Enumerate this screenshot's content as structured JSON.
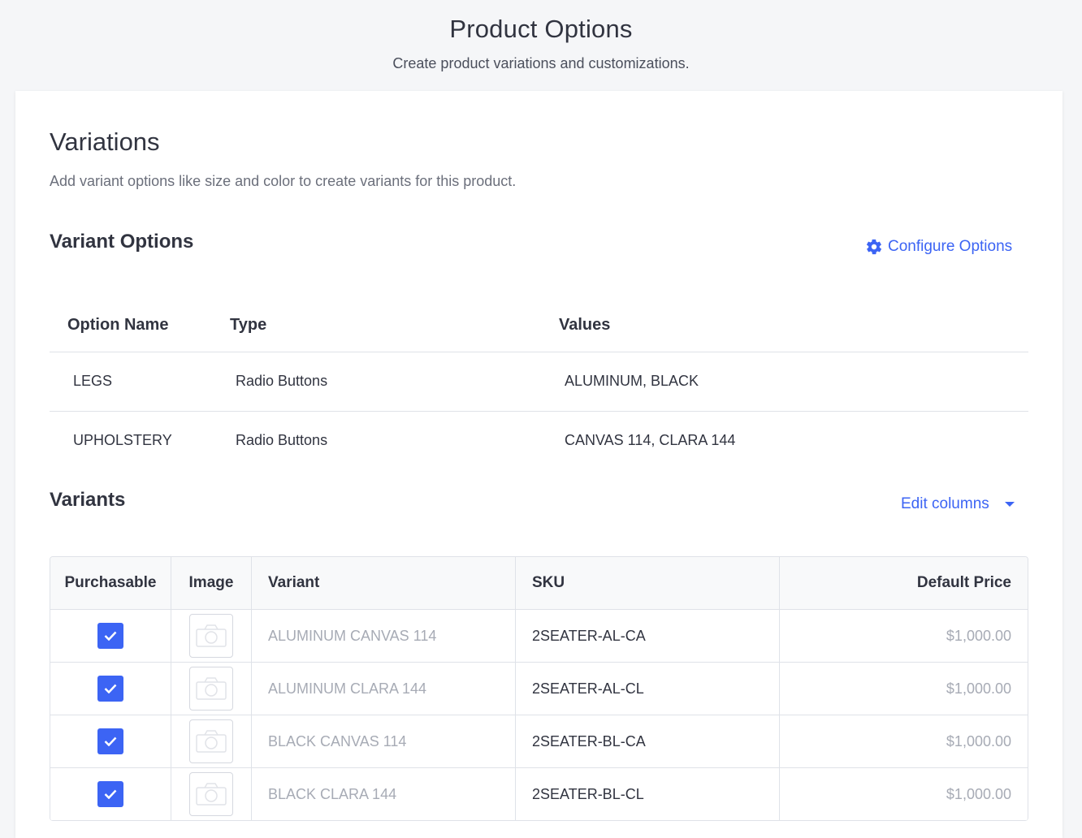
{
  "page": {
    "title": "Product Options",
    "subtitle": "Create product variations and customizations."
  },
  "variations": {
    "title": "Variations",
    "description": "Add variant options like size and color to create variants for this product."
  },
  "variant_options": {
    "title": "Variant Options",
    "configure_label": "Configure Options",
    "columns": [
      "Option Name",
      "Type",
      "Values"
    ],
    "rows": [
      {
        "name": "LEGS",
        "type": "Radio Buttons",
        "values": "ALUMINUM, BLACK"
      },
      {
        "name": "UPHOLSTERY",
        "type": "Radio Buttons",
        "values": "CANVAS 114, CLARA 144"
      }
    ]
  },
  "variants": {
    "title": "Variants",
    "edit_columns_label": "Edit columns",
    "columns": [
      "Purchasable",
      "Image",
      "Variant",
      "SKU",
      "Default Price"
    ],
    "rows": [
      {
        "purchasable": true,
        "variant": "ALUMINUM CANVAS 114",
        "sku": "2SEATER-AL-CA",
        "price": "$1,000.00"
      },
      {
        "purchasable": true,
        "variant": "ALUMINUM CLARA 144",
        "sku": "2SEATER-AL-CL",
        "price": "$1,000.00"
      },
      {
        "purchasable": true,
        "variant": "BLACK CANVAS 114",
        "sku": "2SEATER-BL-CA",
        "price": "$1,000.00"
      },
      {
        "purchasable": true,
        "variant": "BLACK CLARA 144",
        "sku": "2SEATER-BL-CL",
        "price": "$1,000.00"
      }
    ]
  },
  "colors": {
    "accent": "#3c64f4",
    "text": "#313440",
    "muted": "#a7abb5",
    "border": "#dfe2e8"
  },
  "icons": {
    "configure": "gear-icon",
    "edit_columns": "caret-down-icon",
    "checkbox": "checkmark-icon",
    "image_placeholder": "camera-icon"
  }
}
